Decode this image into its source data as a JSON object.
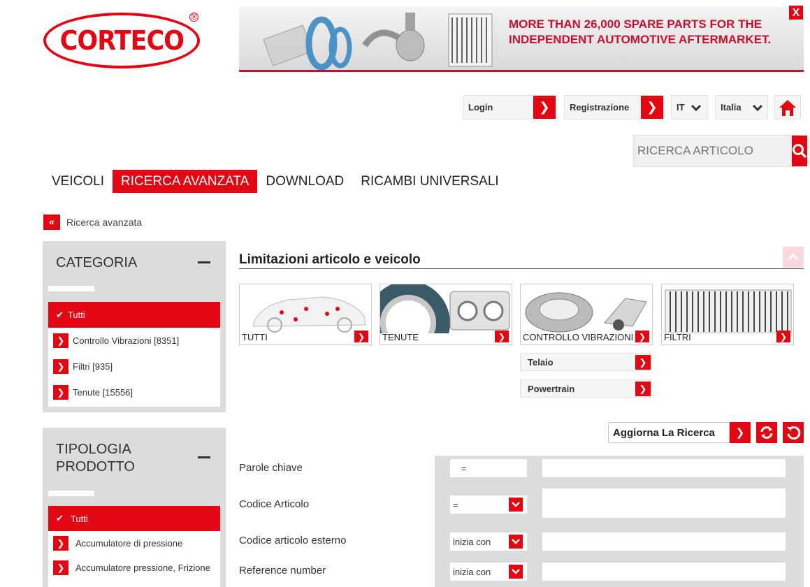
{
  "brand": {
    "logo_text": "CORTECO",
    "logo_mark": "®"
  },
  "banner": {
    "line1": "MORE THAN 26,000 SPARE PARTS FOR THE",
    "line2": "INDEPENDENT AUTOMOTIVE AFTERMARKET.",
    "close_label": "X"
  },
  "topbar": {
    "login": "Login",
    "register": "Registrazione",
    "language": "IT",
    "country": "Italia"
  },
  "search": {
    "placeholder": "RICERCA ARTICOLO"
  },
  "nav": {
    "items": [
      "VEICOLI",
      "RICERCA AVANZATA",
      "DOWNLOAD",
      "RICAMBI UNIVERSALI"
    ],
    "active": 1
  },
  "breadcrumb": {
    "icon": "«",
    "label": "Ricerca avanzata"
  },
  "sidebar": {
    "categoria": {
      "title": "CATEGORIA",
      "items": [
        "Tutti",
        "Controllo Vibrazioni [8351]",
        "Filtri [935]",
        "Tenute [15556]"
      ]
    },
    "tipologia": {
      "title_line1": "TIPOLOGIA",
      "title_line2": "PRODOTTO",
      "items": [
        "Tutti",
        "Accumulatore di pressione",
        "Accumulatore pressione, Frizione"
      ]
    }
  },
  "main": {
    "heading": "Limitazioni articolo e veicolo",
    "tiles": [
      "TUTTI",
      "TENUTE",
      "CONTROLLO VIBRAZIONI",
      "FILTRI"
    ],
    "sub_buttons": [
      "Telaio",
      "Powertrain"
    ],
    "update_label": "Aggiorna La Ricerca"
  },
  "form": {
    "rows": [
      {
        "label": "Parole chiave",
        "operator": "="
      },
      {
        "label": "Codice Articolo",
        "operator": "="
      },
      {
        "label": "Codice articolo esterno",
        "operator": "inizia con"
      },
      {
        "label": "Reference number",
        "operator": "inizia con"
      }
    ]
  },
  "colors": {
    "accent": "#e30613",
    "panel_bg": "#dcdcdc"
  }
}
